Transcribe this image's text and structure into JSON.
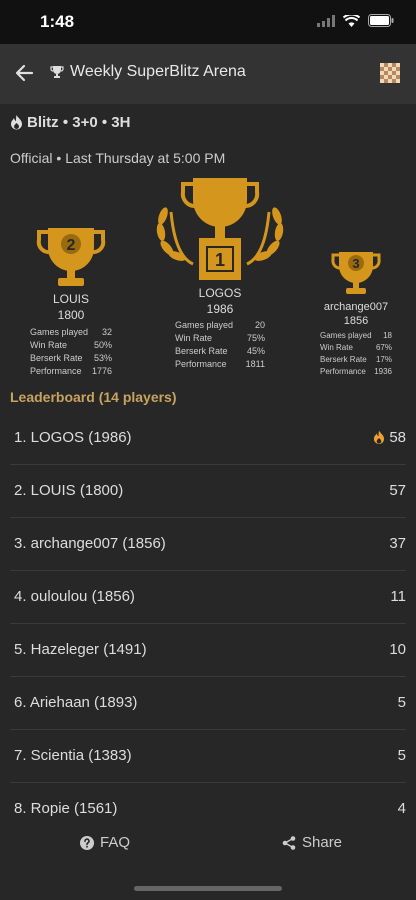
{
  "status": {
    "time": "1:48"
  },
  "header": {
    "title": "Weekly SuperBlitz Arena"
  },
  "tournament": {
    "format": "Blitz • 3+0 • 3H",
    "schedule": "Official • Last Thursday at 5:00 PM"
  },
  "podium": [
    {
      "rank": "2",
      "name": "LOUIS",
      "rating": "1800",
      "stats": [
        [
          "Games played",
          "32"
        ],
        [
          "Win Rate",
          "50%"
        ],
        [
          "Berserk Rate",
          "53%"
        ],
        [
          "Performance",
          "1776"
        ]
      ]
    },
    {
      "rank": "1",
      "name": "LOGOS",
      "rating": "1986",
      "stats": [
        [
          "Games played",
          "20"
        ],
        [
          "Win Rate",
          "75%"
        ],
        [
          "Berserk Rate",
          "45%"
        ],
        [
          "Performance",
          "1811"
        ]
      ]
    },
    {
      "rank": "3",
      "name": "archange007",
      "rating": "1856",
      "stats": [
        [
          "Games played",
          "18"
        ],
        [
          "Win Rate",
          "67%"
        ],
        [
          "Berserk Rate",
          "17%"
        ],
        [
          "Performance",
          "1936"
        ]
      ]
    }
  ],
  "leaderboard": {
    "title": "Leaderboard (14 players)",
    "rows": [
      {
        "label": "1. LOGOS (1986)",
        "score": "58",
        "fire": true
      },
      {
        "label": "2. LOUIS (1800)",
        "score": "57"
      },
      {
        "label": "3. archange007 (1856)",
        "score": "37"
      },
      {
        "label": "4. ouloulou (1856)",
        "score": "11"
      },
      {
        "label": "5. Hazeleger (1491)",
        "score": "10"
      },
      {
        "label": "6. Ariehaan (1893)",
        "score": "5"
      },
      {
        "label": "7. Scientia (1383)",
        "score": "5"
      },
      {
        "label": "8. Ropie (1561)",
        "score": "4"
      }
    ]
  },
  "footer": {
    "faq": "FAQ",
    "share": "Share"
  },
  "colors": {
    "gold": "#d4961c",
    "accent_text": "#c7a35f",
    "fire": "#f0a030"
  }
}
